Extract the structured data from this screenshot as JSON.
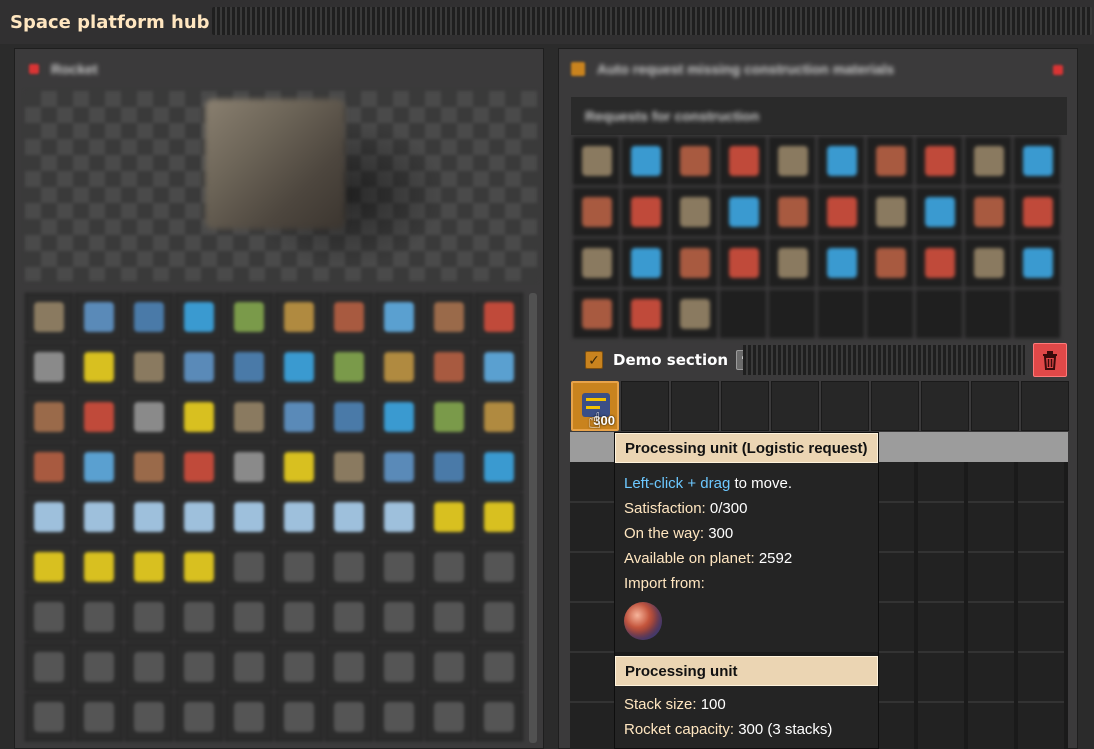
{
  "window": {
    "title": "Space platform hub"
  },
  "left_panel": {
    "header_text": "Rocket",
    "inventory_slots": 90,
    "colors": {
      "bg": "#3b3a3b",
      "slot": "#2c2c2c"
    }
  },
  "right_panel": {
    "header_text": "Auto request missing construction materials",
    "subheader_text": "Requests for construction",
    "request_slots": 33,
    "section": {
      "checked": true,
      "label": "Demo section",
      "edit_icon": "pencil-icon",
      "delete_icon": "trash-icon"
    },
    "active_slot": {
      "icon": "processing-unit-icon",
      "count": "300"
    },
    "accent_color": "#c9831e",
    "delete_color": "#e04848"
  },
  "tooltip": {
    "title": "Processing unit (Logistic request)",
    "instruction_action": "Left-click + drag",
    "instruction_rest": " to move.",
    "satisfaction_label": "Satisfaction:",
    "satisfaction_value": " 0/300",
    "on_the_way_label": "On the way:",
    "on_the_way_value": " 300",
    "available_label": "Available on planet:",
    "available_value": " 2592",
    "import_label": "Import from:",
    "import_icon": "planet-icon",
    "item_title": "Processing unit",
    "stack_label": "Stack size:",
    "stack_value": " 100",
    "rocket_label": "Rocket capacity:",
    "rocket_value": " 300 (3 stacks)",
    "colors": {
      "header_bg": "#ebd5b3",
      "label": "#ffe6c0",
      "link": "#6cc8ff"
    }
  }
}
